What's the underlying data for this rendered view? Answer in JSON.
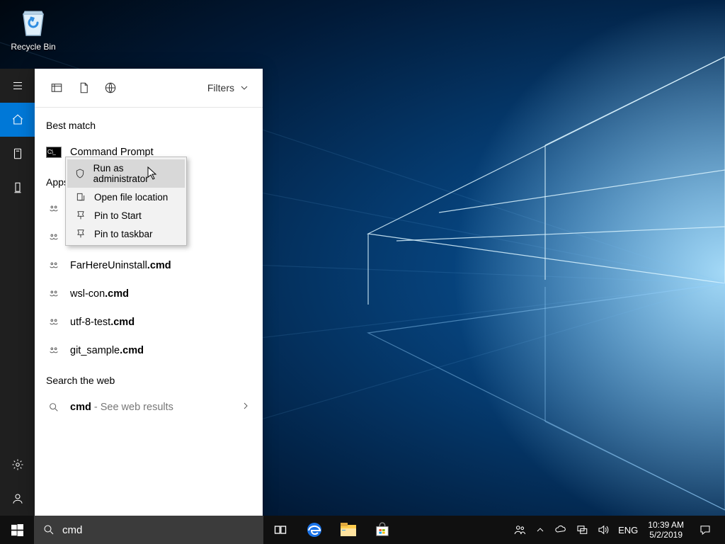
{
  "desktop": {
    "recycle_bin": "Recycle Bin"
  },
  "rail": {
    "items": [
      "menu",
      "home",
      "timeline",
      "this-pc"
    ],
    "bottom": [
      "settings",
      "account"
    ]
  },
  "panel": {
    "filters_label": "Filters",
    "best_match_label": "Best match",
    "best_match_item": "Command Prompt",
    "apps_label": "Apps",
    "apps": [
      {
        "prefix": "FarHereUninstall",
        "suffix": ".cmd"
      },
      {
        "prefix": "wsl-con",
        "suffix": ".cmd"
      },
      {
        "prefix": "utf-8-test",
        "suffix": ".cmd"
      },
      {
        "prefix": "git_sample",
        "suffix": ".cmd"
      }
    ],
    "apps_placeholder1": "",
    "apps_placeholder2": "",
    "web_label": "Search the web",
    "web_query": "cmd",
    "web_suffix": " - See web results"
  },
  "context_menu": {
    "items": [
      "Run as administrator",
      "Open file location",
      "Pin to Start",
      "Pin to taskbar"
    ]
  },
  "taskbar": {
    "search_value": "cmd",
    "lang": "ENG",
    "time": "10:39 AM",
    "date": "5/2/2019"
  }
}
